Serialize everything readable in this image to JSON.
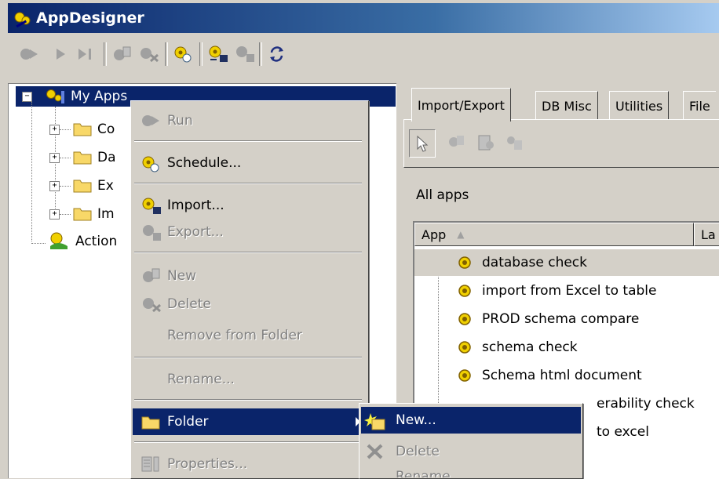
{
  "window": {
    "title": "AppDesigner"
  },
  "toolbar": {
    "buttons": [
      {
        "icon": "run-gear-icon"
      },
      {
        "icon": "play-icon"
      },
      {
        "icon": "step-icon"
      },
      {
        "icon": "new-app-icon"
      },
      {
        "icon": "delete-app-icon"
      },
      {
        "icon": "schedule-icon"
      },
      {
        "icon": "import-icon"
      },
      {
        "icon": "export-icon"
      },
      {
        "icon": "refresh-icon"
      }
    ]
  },
  "tree": {
    "root": "My Apps",
    "children": [
      "Co",
      "Da",
      "Ex",
      "Im"
    ],
    "actions": "Action"
  },
  "right": {
    "tabs": [
      "Import/Export",
      "DB Misc",
      "Utilities",
      "File"
    ],
    "section_label": "All apps",
    "columns": [
      "App",
      "La"
    ],
    "apps": [
      "database check",
      "import from Excel to table",
      "PROD schema compare",
      "schema check",
      "Schema html document"
    ],
    "partial_row_1": "erability check",
    "partial_row_2": "to excel"
  },
  "context_menu": {
    "items": [
      {
        "label": "Run",
        "disabled": true,
        "icon": "run-icon"
      },
      {
        "label": "Schedule...",
        "disabled": false,
        "icon": "schedule-icon"
      },
      {
        "label": "Import...",
        "disabled": false,
        "icon": "import-icon"
      },
      {
        "label": "Export...",
        "disabled": true,
        "icon": "export-icon"
      },
      {
        "label": "New",
        "disabled": true,
        "icon": "new-icon"
      },
      {
        "label": "Delete",
        "disabled": true,
        "icon": "delete-icon"
      },
      {
        "label": "Remove from Folder",
        "disabled": true
      },
      {
        "label": "Rename...",
        "disabled": true
      },
      {
        "label": "Folder",
        "disabled": false,
        "highlighted": true,
        "icon": "folder-icon"
      },
      {
        "label": "Properties...",
        "disabled": true,
        "icon": "properties-icon"
      }
    ]
  },
  "submenu": {
    "items": [
      {
        "label": "New...",
        "disabled": false,
        "highlighted": true,
        "icon": "new-folder-icon"
      },
      {
        "label": "Delete",
        "disabled": true,
        "icon": "delete-x-icon"
      },
      {
        "label": "Rename...",
        "disabled": true
      }
    ]
  },
  "colors": {
    "selection": "#0a246a",
    "face": "#d4d0c8",
    "folder": "#f8d868",
    "gear": "#f0d000"
  }
}
